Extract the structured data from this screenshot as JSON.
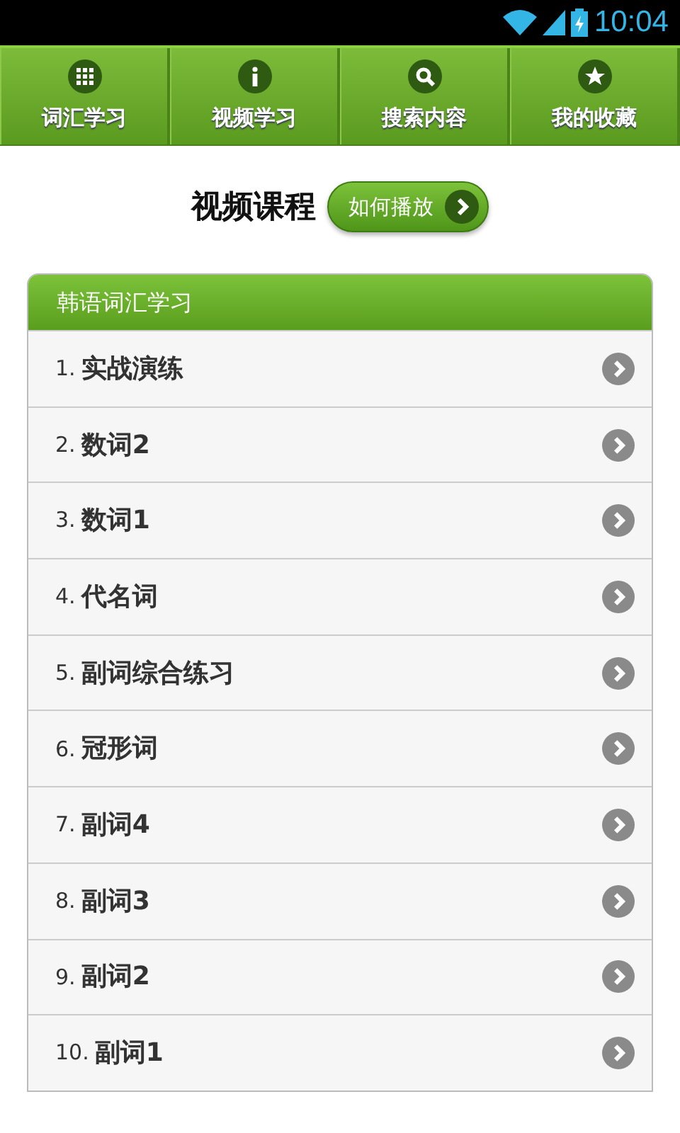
{
  "status_bar": {
    "time": "10:04"
  },
  "nav_tabs": [
    {
      "label": "词汇学习"
    },
    {
      "label": "视频学习"
    },
    {
      "label": "搜索内容"
    },
    {
      "label": "我的收藏"
    }
  ],
  "heading": {
    "title": "视频课程",
    "button": "如何播放"
  },
  "panel": {
    "title": "韩语词汇学习",
    "items": [
      {
        "number": "1.",
        "title": "实战演练"
      },
      {
        "number": "2.",
        "title": "数词2"
      },
      {
        "number": "3.",
        "title": "数词1"
      },
      {
        "number": "4.",
        "title": "代名词"
      },
      {
        "number": "5.",
        "title": "副词综合练习"
      },
      {
        "number": "6.",
        "title": "冠形词"
      },
      {
        "number": "7.",
        "title": "副词4"
      },
      {
        "number": "8.",
        "title": "副词3"
      },
      {
        "number": "9.",
        "title": "副词2"
      },
      {
        "number": "10.",
        "title": "副词1"
      }
    ]
  }
}
